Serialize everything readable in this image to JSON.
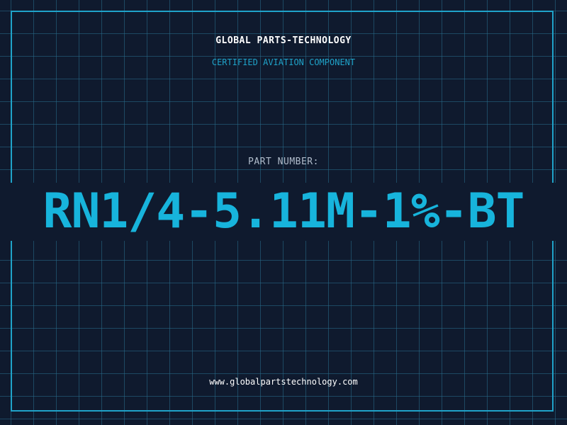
{
  "header": {
    "company": "GLOBAL PARTS-TECHNOLOGY",
    "tagline": "CERTIFIED AVIATION COMPONENT"
  },
  "part": {
    "label": "PART NUMBER:",
    "number": "RN1/4-5.11M-1%-BT"
  },
  "footer": {
    "website": "www.globalpartstechnology.com"
  },
  "colors": {
    "background": "#0f1a2e",
    "accent": "#1fa3c9",
    "part_number": "#17b4dc",
    "text": "#ffffff"
  }
}
